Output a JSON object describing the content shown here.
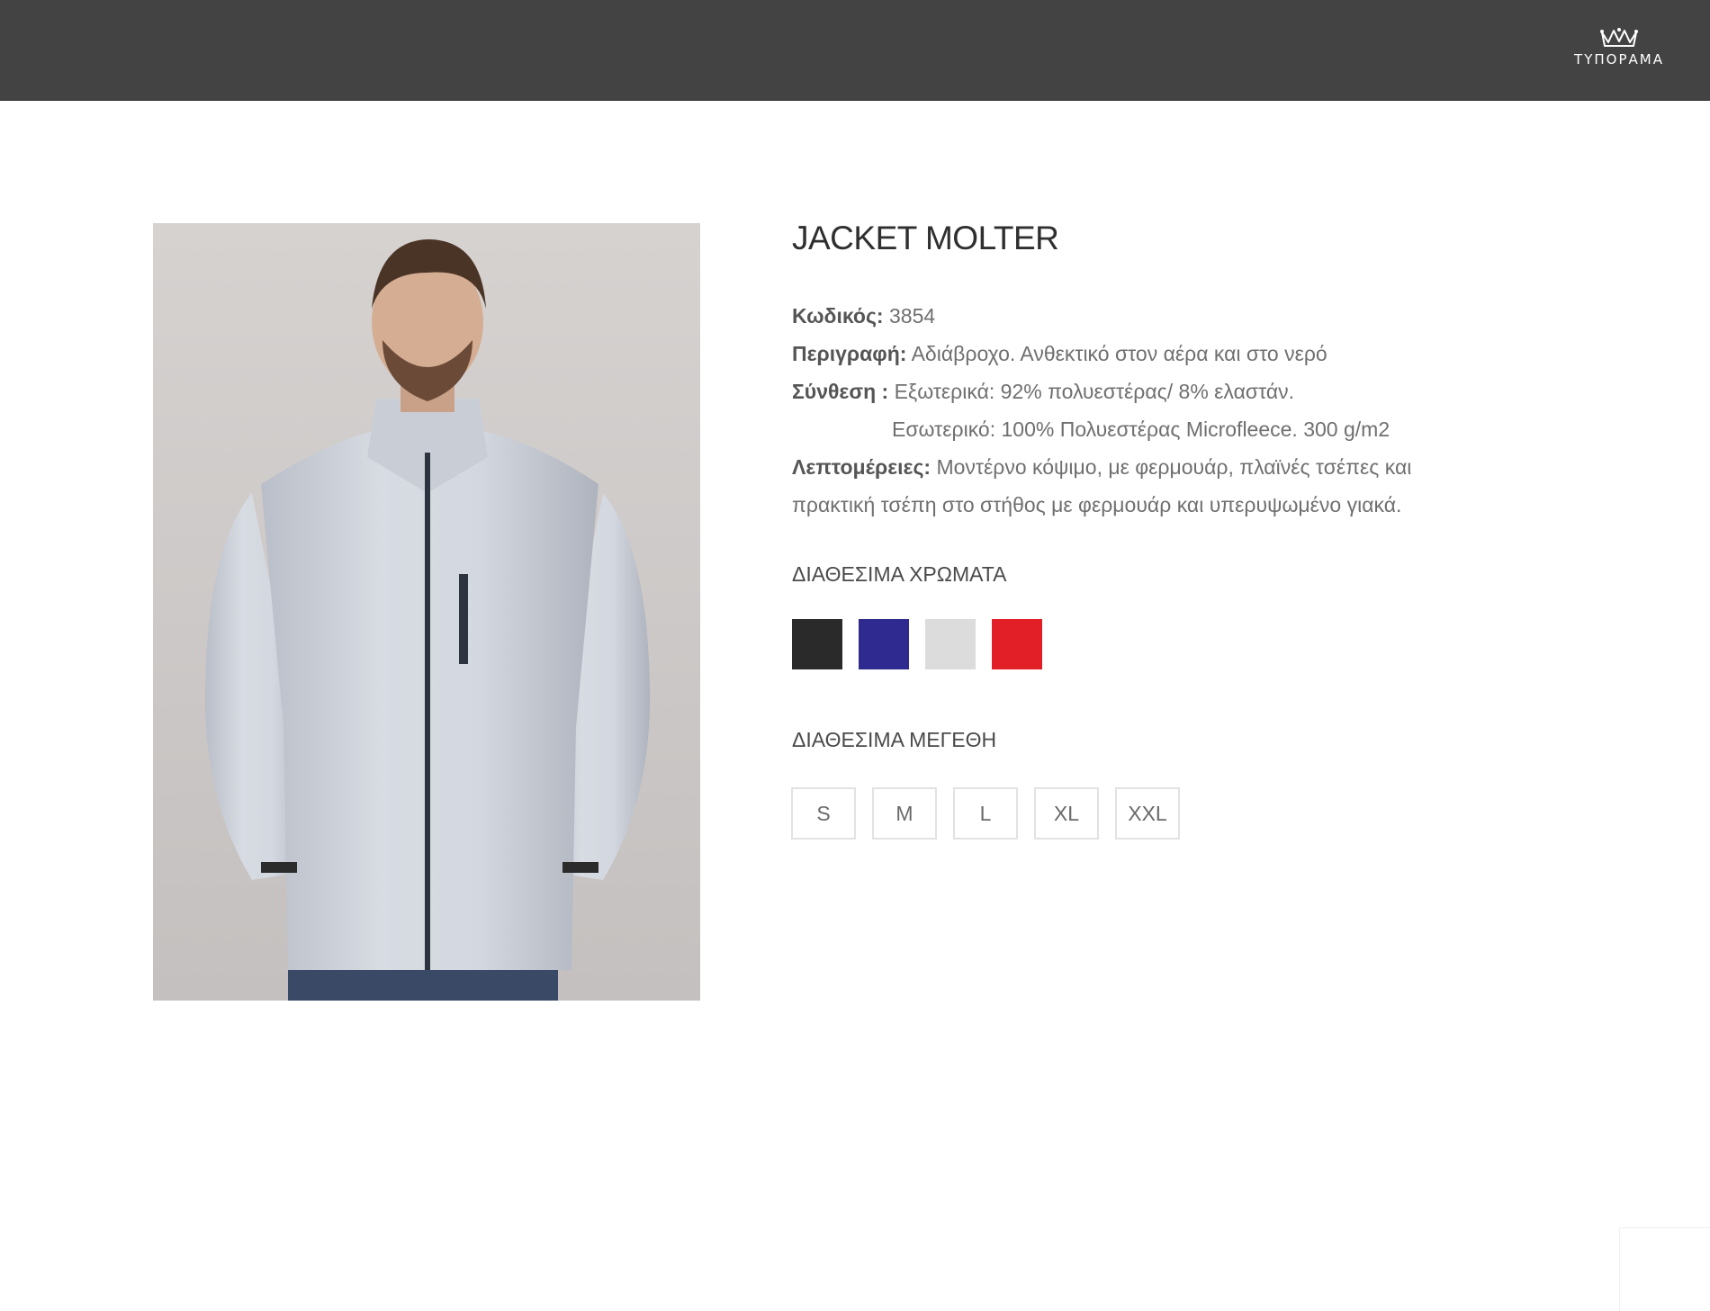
{
  "header": {
    "logo_text": "ΤΥΠΟΡΑΜΑ",
    "background_color": "#434343"
  },
  "product": {
    "title": "JACKET MOLTER",
    "image_icon": "product-photo",
    "code_label": "Κωδικός:",
    "code_value": "3854",
    "description_label": "Περιγραφή:",
    "description_value": "Αδιάβροχο. Ανθεκτικό στον αέρα και στο νερό",
    "composition_label": "Σύνθεση :",
    "composition_outer": "Εξωτερικά: 92% πολυεστέρας/ 8% ελαστάν.",
    "composition_inner": "Εσωτερικό: 100% Πολυεστέρας Microfleece. 300 g/m2",
    "details_label": "Λεπτομέρειες:",
    "details_line1": "Μοντέρνο κόψιμο, με φερμουάρ, πλαϊνές τσέπες και",
    "details_line2": "πρακτική τσέπη στο στήθος με φερμουάρ και υπερυψωμένο γιακά."
  },
  "colors": {
    "heading": "ΔΙΑΘΕΣΙΜΑ ΧΡΩΜΑΤΑ",
    "swatches": [
      "#2a2a2a",
      "#2e2a8f",
      "#dcdcdc",
      "#e21f26"
    ]
  },
  "sizes": {
    "heading": "ΔΙΑΘΕΣΙΜΑ ΜΕΓΕΘΗ",
    "options": [
      "S",
      "M",
      "L",
      "XL",
      "XXL"
    ]
  }
}
